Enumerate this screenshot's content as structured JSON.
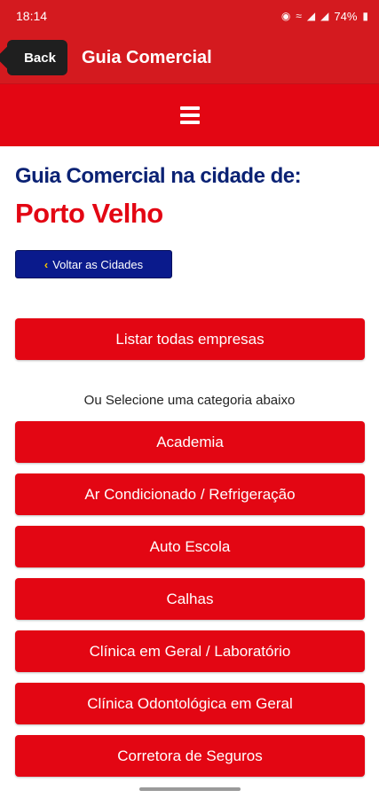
{
  "status_bar": {
    "time": "18:14",
    "battery": "74%"
  },
  "app_bar": {
    "back_label": "Back",
    "title": "Guia Comercial"
  },
  "main": {
    "heading": "Guia Comercial na cidade de:",
    "city": "Porto Velho",
    "back_to_cities": "Voltar as Cidades",
    "list_all": "Listar todas empresas",
    "category_prompt": "Ou Selecione uma categoria abaixo",
    "categories": [
      "Academia",
      "Ar Condicionado / Refrigeração",
      "Auto Escola",
      "Calhas",
      "Clínica em Geral / Laboratório",
      "Clínica Odontológica em Geral",
      "Corretora de Seguros"
    ]
  },
  "colors": {
    "primary_red": "#e30613",
    "dark_red": "#d41a1f",
    "navy": "#0b2274",
    "button_blue": "#0a1a8c"
  },
  "icons": {
    "menu": "hamburger-icon",
    "back_chevron": "chevron-left-icon",
    "location": "location-icon",
    "wifi": "wifi-icon",
    "signal": "signal-icon",
    "battery": "battery-icon"
  }
}
